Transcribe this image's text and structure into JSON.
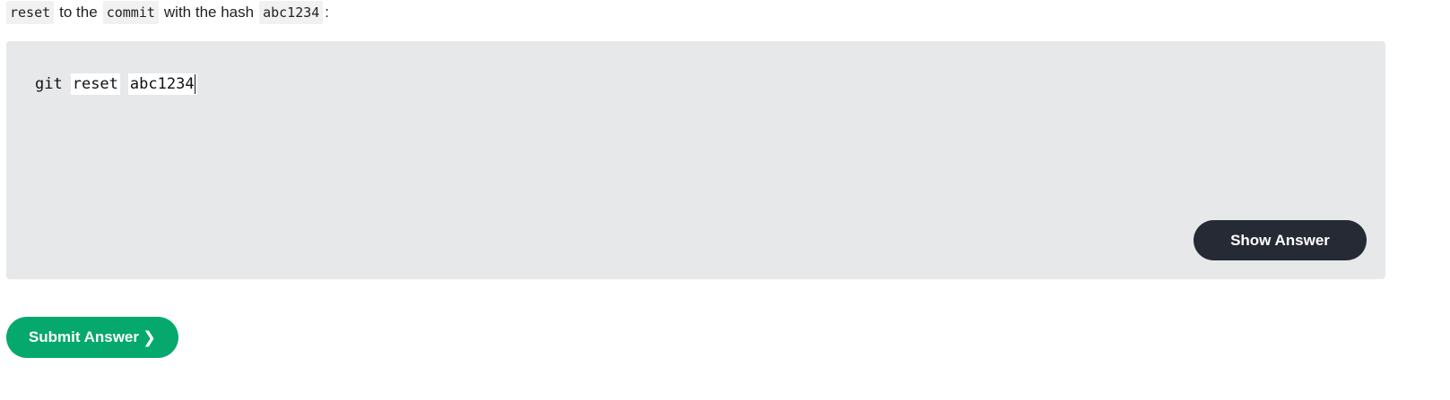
{
  "instruction": {
    "code1": "reset",
    "text1": "to the",
    "code2": "commit",
    "text2": "with the hash",
    "code3": "abc1234",
    "text3": ":"
  },
  "exercise": {
    "command": "git",
    "token1": "reset",
    "token2": "abc1234",
    "show_answer_label": "Show Answer"
  },
  "submit": {
    "label": "Submit Answer",
    "icon": "chevron-right-icon"
  },
  "colors": {
    "exercise_bg": "#e7e8ea",
    "show_answer_bg": "#262a35",
    "submit_bg": "#05a86d"
  }
}
